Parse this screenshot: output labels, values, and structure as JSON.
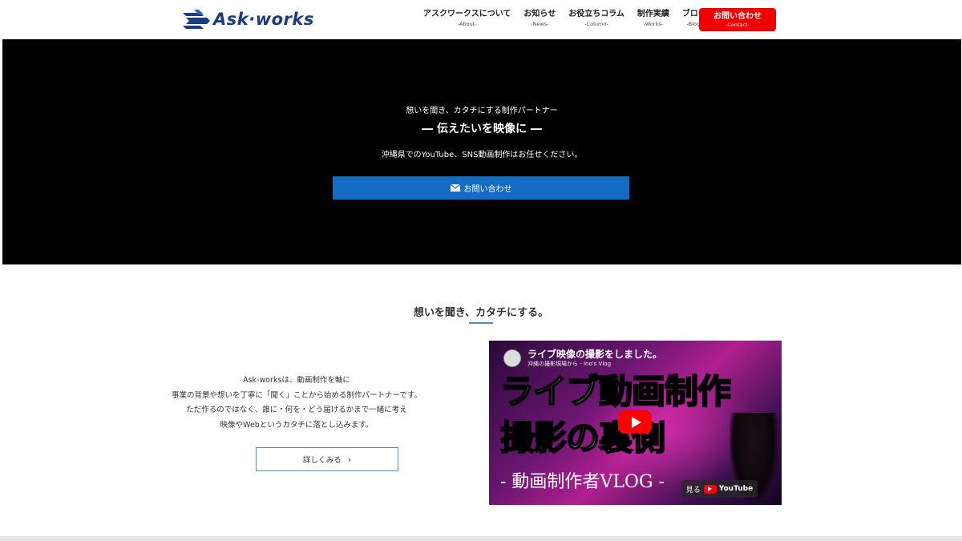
{
  "header": {
    "logo_text": "Ask·works",
    "nav": [
      {
        "label": "アスクワークスについて",
        "sub": "-About-"
      },
      {
        "label": "お知らせ",
        "sub": "-News-"
      },
      {
        "label": "お役立ちコラム",
        "sub": "-Column-"
      },
      {
        "label": "制作実績",
        "sub": "-Works-"
      },
      {
        "label": "ブログ",
        "sub": "-Blog-"
      }
    ],
    "contact": {
      "label": "お問い合わせ",
      "sub": "-Contact-"
    }
  },
  "hero": {
    "tagline": "想いを聞き、カタチにする制作パートナー",
    "title": "― 伝えたいを映像に ―",
    "description": "沖縄県でのYouTube、SNS動画制作はお任せください。",
    "button_label": "お問い合わせ"
  },
  "section": {
    "title": "想いを聞き、カタチにする。",
    "lines": [
      "Ask-worksは、動画制作を軸に",
      "事業の背景や想いを丁寧に「聞く」ことから始める制作パートナーです。",
      "ただ作るのではなく、誰に・何を・どう届けるかまで一緒に考え",
      "映像やWebというカタチに落とし込みます。"
    ],
    "more_label": "詳しくみる"
  },
  "video": {
    "title": "ライブ映像の撮影をしました。",
    "channel": "沖縄の撮影現場から - Ino's Vlog",
    "line1": "ライブ動画制作",
    "line2": "撮影の裏側",
    "vlog": "- 動画制作者VLOG -",
    "watch_label": "見る",
    "youtube_label": "YouTube"
  },
  "colors": {
    "brand_navy": "#1b3d7e",
    "contact_red": "#f00000",
    "hero_button_blue": "#146bc6",
    "accent_blue": "#4a90c2"
  }
}
